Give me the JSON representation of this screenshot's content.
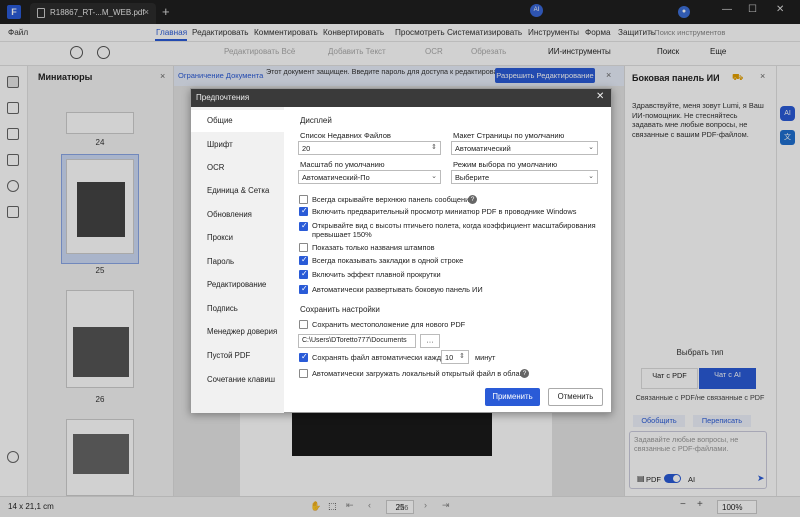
{
  "titlebar": {
    "tab_label": "R18867_RT-...M_WEB.pdf",
    "close": "×",
    "new_tab": "+",
    "minimize": "—",
    "maximize": "☐",
    "window_close": "✕"
  },
  "menu": {
    "items": [
      "Файл",
      "Главная",
      "Редактировать",
      "Комментировать",
      "Конвертировать",
      "Просмотреть",
      "Систематизировать",
      "Инструменты",
      "Форма",
      "Защитить"
    ],
    "active": "Главная",
    "search_tools": "Поиск инструментов"
  },
  "toolbar": {
    "edit_all": "Редактировать Всё",
    "add_text": "Добавить Текст",
    "ocr": "OCR",
    "crop": "Обрезать",
    "ai_tools": "ИИ-инструменты",
    "search": "Поиск",
    "more": "Еще"
  },
  "thumbnails": {
    "title": "Миниатюры",
    "pages": [
      "24",
      "25",
      "26"
    ]
  },
  "notice": {
    "label": "Ограничение Документа",
    "message": "Этот документ защищен. Введите пароль для доступа к редактированию",
    "button": "Разрешить Редактирование"
  },
  "dialog": {
    "title": "Предпочтения",
    "nav": [
      "Общие",
      "Шрифт",
      "OCR",
      "Единица & Сетка",
      "Обновления",
      "Прокси",
      "Пароль",
      "Редактирование",
      "Подпись",
      "Менеджер доверия",
      "Пустой PDF",
      "Сочетание клавиш"
    ],
    "selected_nav": "Общие",
    "display_section": "Дисплей",
    "recent_files_label": "Список Недавних Файлов",
    "recent_files_value": "20",
    "page_layout_label": "Макет Страницы по умолчанию",
    "page_layout_value": "Автоматический",
    "zoom_label": "Масштаб по умолчанию",
    "zoom_value": "Автоматический-По",
    "select_mode_label": "Режим выбора по умолчанию",
    "select_mode_value": "Выберите",
    "checkboxes": [
      {
        "label": "Всегда скрывайте верхнюю панель сообщений",
        "checked": false
      },
      {
        "label": "Включить предварительный просмотр миниатюр PDF в проводнике Windows",
        "checked": true
      },
      {
        "label": "Открывайте вид с высоты птичьего полета, когда коэффициент масштабирования превышает 150%",
        "checked": true
      },
      {
        "label": "Показать только названия штампов",
        "checked": false
      },
      {
        "label": "Всегда показывать закладки в одной строке",
        "checked": true
      },
      {
        "label": "Включить эффект плавной прокрутки",
        "checked": true
      },
      {
        "label": "Автоматически развертывать боковую панель ИИ",
        "checked": true
      }
    ],
    "save_section": "Сохранить настройки",
    "save_location_label": "Сохранить местоположение для нового PDF",
    "save_path": "C:\\Users\\DToretto777\\Documents",
    "browse": "···",
    "autosave_label": "Сохранять файл автоматически каждые",
    "autosave_value": "10",
    "autosave_unit": "минут",
    "autoupload_label": "Автоматически загружать локальный открытый файл в облако.",
    "apply": "Применить",
    "cancel": "Отменить"
  },
  "ai_panel": {
    "title": "Боковая панель ИИ",
    "greeting": "Здравствуйте, меня зовут Lumi, я Ваш ИИ-помощник. Не стесняйтесь задавать мне любые вопросы, не связанные с вашим PDF-файлом.",
    "choose_type": "Выбрать тип",
    "option_pdf": "Чат с PDF",
    "option_ai": "Чат с AI",
    "subtitle": "Связанные с PDF/не связанные с PDF",
    "summarize": "Обобщить",
    "rewrite": "Переписать",
    "input_placeholder": "Задавайте любые вопросы, не связанные с PDF-файлами.",
    "toggle_pdf": "PDF",
    "toggle_ai": "AI",
    "toggle_on": true
  },
  "status": {
    "size": "14 x 21,1 cm",
    "page": "25",
    "total": "/26",
    "zoom": "100%"
  },
  "colors": {
    "accent": "#2a5bd7",
    "titlebar": "#1f1f1f"
  }
}
